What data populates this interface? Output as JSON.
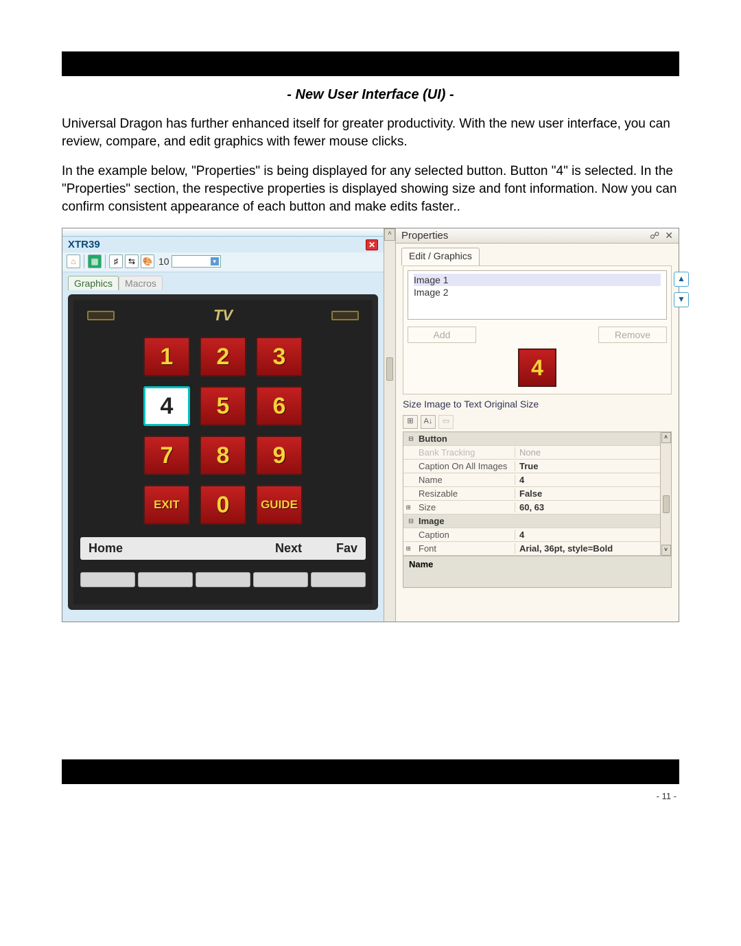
{
  "section_title": "- New User Interface (UI) -",
  "para1": "Universal Dragon has further enhanced itself for greater productivity. With the new user interface, you can review, compare, and edit graphics with fewer mouse clicks.",
  "para2": "In the example below, \"Properties\" is being displayed for any selected button. Button \"4\" is selected. In the \"Properties\" section, the respective properties is displayed showing size and font information. Now you can confirm consistent appearance of each button and make edits faster..",
  "left": {
    "device": "XTR39",
    "toolbar_num": "10",
    "tabs": [
      "Graphics",
      "Macros"
    ],
    "tv_label": "TV",
    "numpad": [
      "1",
      "2",
      "3",
      "4",
      "5",
      "6",
      "7",
      "8",
      "9",
      "EXIT",
      "0",
      "GUIDE"
    ],
    "selected": "4",
    "soft": [
      "Home",
      "Next",
      "Fav"
    ]
  },
  "right": {
    "panel": "Properties",
    "tab": "Edit / Graphics",
    "images": [
      "Image 1",
      "Image 2"
    ],
    "add": "Add",
    "remove": "Remove",
    "preview": "4",
    "size_links": "Size Image to Text   Original Size",
    "grid": {
      "button_header": "Button",
      "rows": [
        {
          "k": "Bank Tracking",
          "v": "None",
          "grey": true
        },
        {
          "k": "Caption On All Images",
          "v": "True",
          "bold": true
        },
        {
          "k": "Name",
          "v": "4",
          "bold": true
        },
        {
          "k": "Resizable",
          "v": "False",
          "bold": true
        }
      ],
      "size_header": "Size",
      "size_v": "60, 63",
      "image_header": "Image",
      "caption_k": "Caption",
      "caption_v": "4",
      "font_header": "Font",
      "font_v": "Arial, 36pt, style=Bold"
    },
    "footer": "Name"
  },
  "page_num": "- 11 -"
}
